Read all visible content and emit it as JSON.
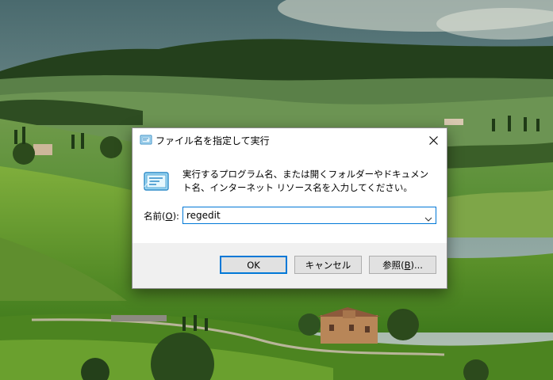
{
  "wallpaper": {
    "description_icon": "tuscany-landscape"
  },
  "dialog": {
    "title": "ファイル名を指定して実行",
    "description": "実行するプログラム名、または開くフォルダーやドキュメント名、インターネット リソース名を入力してください。",
    "name_label_prefix": "名前(",
    "name_label_key": "O",
    "name_label_suffix": "):",
    "input_value": "regedit",
    "buttons": {
      "ok": "OK",
      "cancel": "キャンセル",
      "browse_prefix": "参照(",
      "browse_key": "B",
      "browse_suffix": ")..."
    },
    "icons": {
      "title_icon": "run-icon",
      "big_icon": "run-icon",
      "close_icon": "close-icon",
      "dropdown_icon": "chevron-down-icon"
    },
    "colors": {
      "accent": "#0078d7",
      "footer": "#f0f0f0"
    }
  }
}
